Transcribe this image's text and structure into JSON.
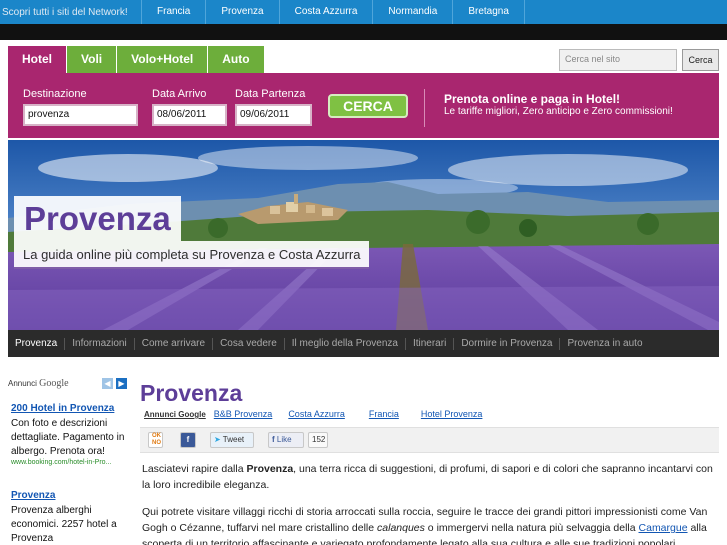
{
  "network_bar": {
    "intro": "Scopri tutti i siti del Network!",
    "items": [
      "Francia",
      "Provenza",
      "Costa Azzurra",
      "Normandia",
      "Bretagna"
    ]
  },
  "booking": {
    "tabs": [
      "Hotel",
      "Voli",
      "Volo+Hotel",
      "Auto"
    ],
    "active_tab": "Hotel",
    "site_search_placeholder": "Cerca nel sito",
    "site_search_button": "Cerca",
    "destination_label": "Destinazione",
    "destination_value": "provenza",
    "arrival_label": "Data Arrivo",
    "arrival_value": "08/06/2011",
    "departure_label": "Data Partenza",
    "departure_value": "09/06/2011",
    "search_button": "CERCA",
    "promo_title": "Prenota online e paga in Hotel!",
    "promo_text": "Le tariffe migliori, Zero anticipo e Zero commissioni!"
  },
  "hero": {
    "title": "Provenza",
    "subtitle": "La guida online più completa su Provenza e Costa Azzurra"
  },
  "section_nav": [
    "Provenza",
    "Informazioni",
    "Come arrivare",
    "Cosa vedere",
    "Il meglio della Provenza",
    "Itinerari",
    "Dormire in Provenza",
    "Provenza in auto"
  ],
  "ads": {
    "label_prefix": "Annunci",
    "label_brand": "Google",
    "items": [
      {
        "title": "200 Hotel in Provenza",
        "text": "Con foto e descrizioni dettagliate. Pagamento in albergo. Prenota ora!",
        "url": "www.booking.com/hotel-in-Pro..."
      },
      {
        "title": "Provenza",
        "text": "Provenza alberghi economici. 2257 hotel a Provenza",
        "url": ""
      }
    ]
  },
  "main": {
    "title": "Provenza",
    "ad_links_label": "Annunci Google",
    "ad_links": [
      "B&B Provenza",
      "Costa Azzurra",
      "Francia",
      "Hotel Provenza"
    ],
    "share": {
      "okno": "OK NO",
      "fb": "f",
      "tweet": "Tweet",
      "like": "Like",
      "like_count": "152"
    },
    "para1_a": "Lasciatevi rapire dalla ",
    "para1_b": "Provenza",
    "para1_c": ", una terra ricca di suggestioni, di profumi, di sapori e di colori che sapranno incantarvi con la loro incredibile eleganza.",
    "para2_a": "Qui potrete visitare villaggi ricchi di storia arroccati sulla roccia, seguire le tracce dei grandi pittori impressionisti come Van Gogh o Cézanne, tuffarvi nel mare cristallino delle ",
    "para2_b": "calanques",
    "para2_c": " o immergervi nella natura più selvaggia della ",
    "para2_link": "Camargue",
    "para2_d": " alla scoperta di un territorio affascinante e variegato profondamente legato alla sua cultura e alle sue tradizioni popolari."
  },
  "colors": {
    "network_blue": "#1b86c9",
    "magenta": "#a9266f",
    "green": "#6dae3b",
    "purple_title": "#5d3e98",
    "link_blue": "#1256b3"
  }
}
